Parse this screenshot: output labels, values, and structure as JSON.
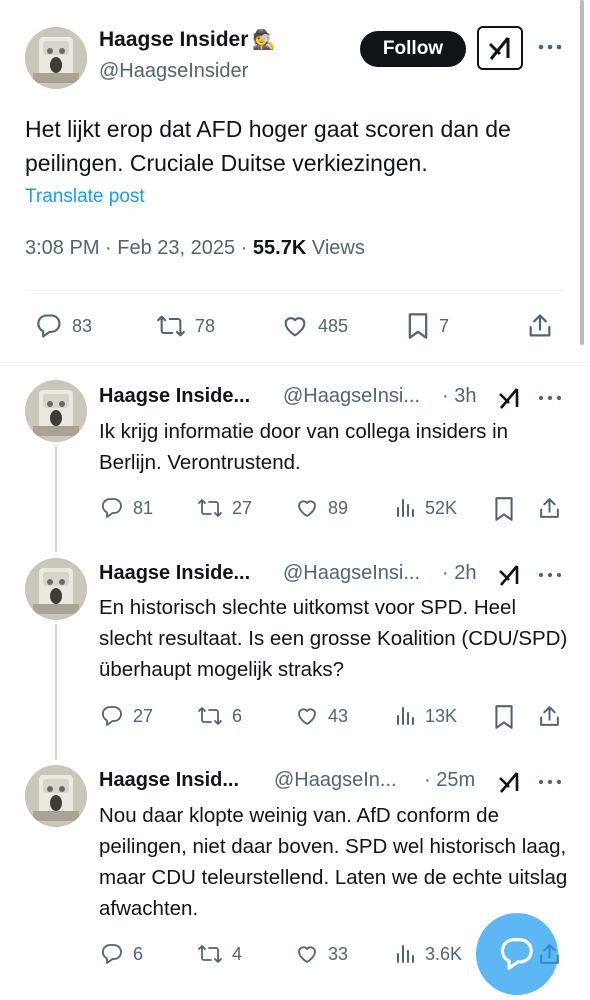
{
  "main_post": {
    "display_name": "Haagse Insider",
    "name_emoji": "🕵️",
    "handle": "@HaagseInsider",
    "follow_label": "Follow",
    "text": "Het lijkt erop dat AFD hoger gaat scoren dan de peilingen. Cruciale Duitse verkiezingen.",
    "translate_label": "Translate post",
    "time": "3:08 PM · Feb 23, 2025 · ",
    "views_count": "55.7K",
    "views_label": " Views",
    "actions": {
      "replies": "83",
      "reposts": "78",
      "likes": "485",
      "bookmarks": "7"
    }
  },
  "replies": [
    {
      "display_name": "Haagse Inside...",
      "handle": "@HaagseInsi...",
      "time": "· 3h",
      "text": "Ik krijg informatie door van collega insiders in Berlijn. Verontrustend.",
      "stats": {
        "replies": "81",
        "reposts": "27",
        "likes": "89",
        "views": "52K"
      }
    },
    {
      "display_name": "Haagse Inside...",
      "handle": "@HaagseInsi...",
      "time": "· 2h",
      "text": "En historisch slechte uitkomst voor SPD. Heel slecht resultaat. Is een grosse Koalition (CDU/SPD) überhaupt mogelijk straks?",
      "stats": {
        "replies": "27",
        "reposts": "6",
        "likes": "43",
        "views": "13K"
      }
    },
    {
      "display_name": "Haagse Insid...",
      "handle": "@HaagseIn...",
      "time": "· 25m",
      "text": "Nou daar klopte weinig van. AfD conform de peilingen, niet daar boven. SPD wel historisch laag, maar CDU teleurstellend. Laten we de echte uitslag afwachten.",
      "stats": {
        "replies": "6",
        "reposts": "4",
        "likes": "33",
        "views": "3.6K"
      }
    }
  ],
  "colors": {
    "accent": "#1d9bf0",
    "text": "#0f1419",
    "secondary": "#536471",
    "divider": "#eff3f4"
  },
  "icons": [
    "avatar",
    "grok-icon",
    "more-icon",
    "reply-icon",
    "repost-icon",
    "like-icon",
    "bookmark-icon",
    "share-icon",
    "views-icon",
    "compose-reply-icon"
  ]
}
